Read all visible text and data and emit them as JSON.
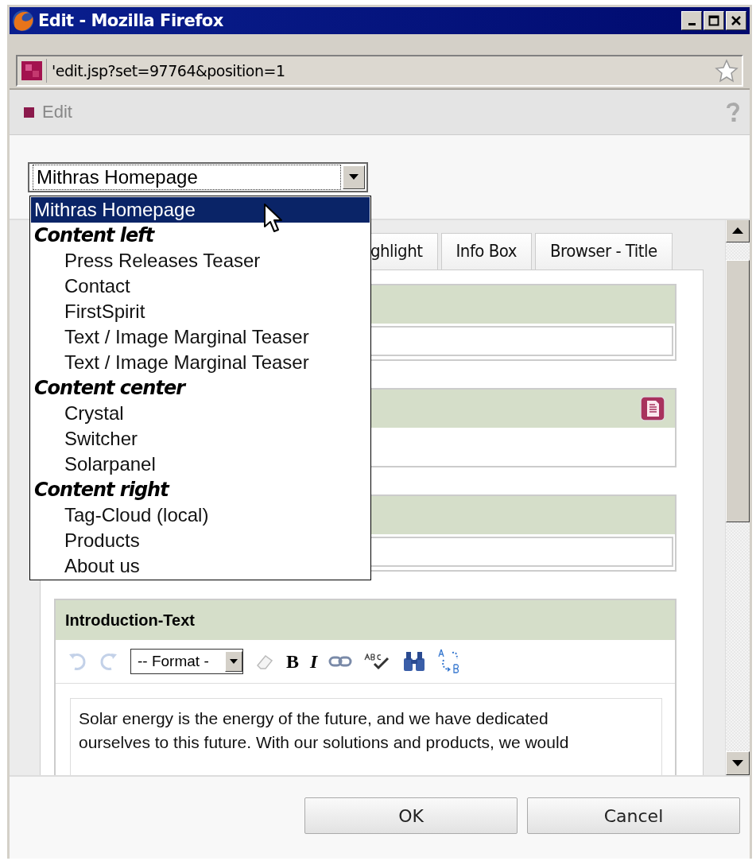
{
  "window": {
    "title": "Edit - Mozilla Firefox"
  },
  "address_bar": {
    "url": "'edit.jsp?set=97764&position=1"
  },
  "header": {
    "title": "Edit"
  },
  "page_select": {
    "value": "Mithras Homepage",
    "expanded": true,
    "options": [
      {
        "kind": "option",
        "label": "Mithras Homepage",
        "selected": true
      },
      {
        "kind": "group",
        "label": "Content left",
        "options": [
          {
            "label": "Press Releases Teaser",
            "selected": false
          },
          {
            "label": "Contact",
            "selected": false
          },
          {
            "label": "FirstSpirit",
            "selected": false
          },
          {
            "label": "Text / Image Marginal Teaser",
            "selected": false
          },
          {
            "label": "Text / Image Marginal Teaser",
            "selected": false
          }
        ]
      },
      {
        "kind": "group",
        "label": "Content center",
        "options": [
          {
            "label": "Crystal",
            "selected": false
          },
          {
            "label": "Switcher",
            "selected": false
          },
          {
            "label": "Solarpanel",
            "selected": false
          }
        ]
      },
      {
        "kind": "group",
        "label": "Content right",
        "options": [
          {
            "label": "Tag-Cloud (local)",
            "selected": false
          },
          {
            "label": "Products",
            "selected": false
          },
          {
            "label": "About us",
            "selected": false
          }
        ]
      }
    ]
  },
  "tabs": [
    {
      "label": "ghlight",
      "selected": false
    },
    {
      "label": "Info Box",
      "selected": false
    },
    {
      "label": "Browser - Title",
      "selected": false
    }
  ],
  "fields": [
    {
      "kind": "input"
    },
    {
      "kind": "picker"
    },
    {
      "kind": "input"
    }
  ],
  "introduction": {
    "title": "Introduction-Text",
    "toolbar": {
      "undo_disabled": true,
      "redo_disabled": true,
      "format": "-- Format -",
      "bold": "B",
      "italic": "I"
    },
    "text": "Solar energy is the energy of the future, and we have dedicated ourselves to this future. With our solutions and products, we would"
  },
  "buttons": [
    "OK",
    "Cancel"
  ]
}
